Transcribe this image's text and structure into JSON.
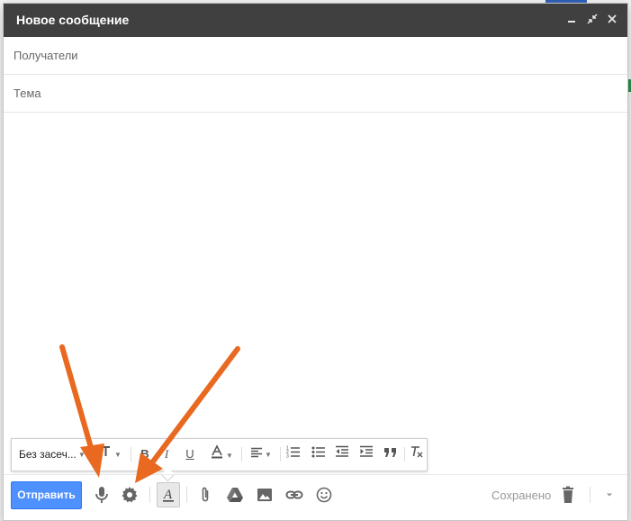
{
  "window": {
    "title": "Новое сообщение"
  },
  "fields": {
    "recipients_placeholder": "Получатели",
    "subject_placeholder": "Тема"
  },
  "format_bar": {
    "font_label": "Без засеч..."
  },
  "bottom_bar": {
    "send_label": "Отправить",
    "saved_status": "Сохранено"
  },
  "colors": {
    "titlebar": "#404040",
    "send_button": "#4d90fe",
    "arrows": "#e8691f"
  }
}
